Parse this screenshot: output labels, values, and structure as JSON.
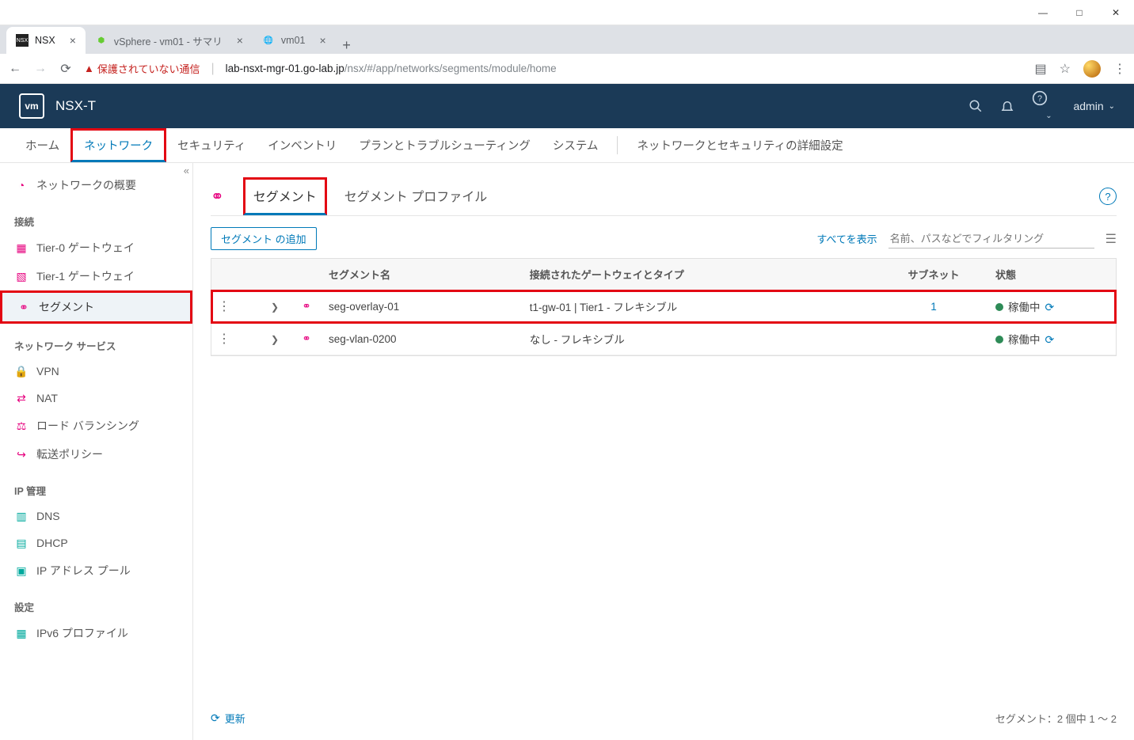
{
  "window": {
    "min": "—",
    "max": "□",
    "close": "✕"
  },
  "browser_tabs": [
    {
      "favicon": "NSX",
      "title": "NSX",
      "active": true
    },
    {
      "favicon": "v",
      "title": "vSphere - vm01 - サマリ",
      "active": false
    },
    {
      "favicon": "●",
      "title": "vm01",
      "active": false
    }
  ],
  "addr": {
    "warn": "保護されていない通信",
    "host": "lab-nsxt-mgr-01.go-lab.jp",
    "path": "/nsx/#/app/networks/segments/module/home"
  },
  "nsx": {
    "logo": "vm",
    "title": "NSX-T",
    "user": "admin"
  },
  "main_tabs": {
    "home": "ホーム",
    "network": "ネットワーク",
    "security": "セキュリティ",
    "inventory": "インベントリ",
    "plan": "プランとトラブルシューティング",
    "system": "システム",
    "advanced": "ネットワークとセキュリティの詳細設定"
  },
  "sidebar": {
    "overview": "ネットワークの概要",
    "sec_connect": "接続",
    "tier0": "Tier-0 ゲートウェイ",
    "tier1": "Tier-1 ゲートウェイ",
    "segments": "セグメント",
    "sec_net_svc": "ネットワーク サービス",
    "vpn": "VPN",
    "nat": "NAT",
    "lb": "ロード バランシング",
    "fwd": "転送ポリシー",
    "sec_ip": "IP 管理",
    "dns": "DNS",
    "dhcp": "DHCP",
    "ip_pool": "IP アドレス プール",
    "sec_settings": "設定",
    "ipv6": "IPv6 プロファイル"
  },
  "content": {
    "tab_segment": "セグメント",
    "tab_profile": "セグメント プロファイル",
    "add_btn": "セグメント の追加",
    "show_all": "すべてを表示",
    "filter_placeholder": "名前、パスなどでフィルタリング",
    "cols": {
      "name": "セグメント名",
      "gw": "接続されたゲートウェイとタイプ",
      "subnet": "サブネット",
      "status": "状態"
    },
    "rows": [
      {
        "name": "seg-overlay-01",
        "gw": "t1-gw-01 | Tier1 - フレキシブル",
        "subnet": "1",
        "status": "稼働中",
        "highlighted": true
      },
      {
        "name": "seg-vlan-0200",
        "gw": "なし - フレキシブル",
        "subnet": "",
        "status": "稼働中",
        "highlighted": false
      }
    ],
    "refresh": "更新",
    "footer": "セグメント：2 個中 1 ～ 2"
  }
}
